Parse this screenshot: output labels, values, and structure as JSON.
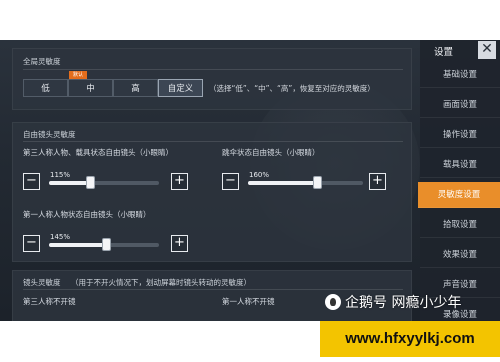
{
  "global_sensitivity": {
    "title": "全局灵敏度",
    "options": [
      "低",
      "中",
      "高",
      "自定义"
    ],
    "recommended_badge": "默认",
    "selected_option": "自定义",
    "hint": "（选择“低”、“中”、“高”，恢复至对应的灵敏度）"
  },
  "free_camera": {
    "title": "自由镜头灵敏度",
    "sliders": [
      {
        "label": "第三人称人物、载具状态自由镜头（小眼睛）",
        "value_text": "115%",
        "value_fraction": 0.37
      },
      {
        "label": "跳伞状态自由镜头（小眼睛）",
        "value_text": "160%",
        "value_fraction": 0.6
      },
      {
        "label": "第一人称人物状态自由镜头（小眼睛）",
        "value_text": "145%",
        "value_fraction": 0.52
      }
    ]
  },
  "camera_sensitivity": {
    "title": "镜头灵敏度",
    "note": "（用于不开火情况下，划动屏幕时镜头转动的灵敏度）",
    "left_label": "第三人称不开镜",
    "right_label": "第一人称不开镜"
  },
  "sidebar": {
    "title": "设置",
    "close_label": "✕",
    "items": [
      "基础设置",
      "画面设置",
      "操作设置",
      "载具设置",
      "灵敏度设置",
      "拾取设置",
      "效果设置",
      "声音设置",
      "录像设置"
    ],
    "active_index": 4
  },
  "watermark": {
    "text": "企鹅号 网瘾小少年"
  },
  "url_banner": {
    "text": "www.hfxyylkj.com"
  },
  "colors": {
    "accent": "#e98e2a",
    "url_banner": "#f3c400"
  }
}
